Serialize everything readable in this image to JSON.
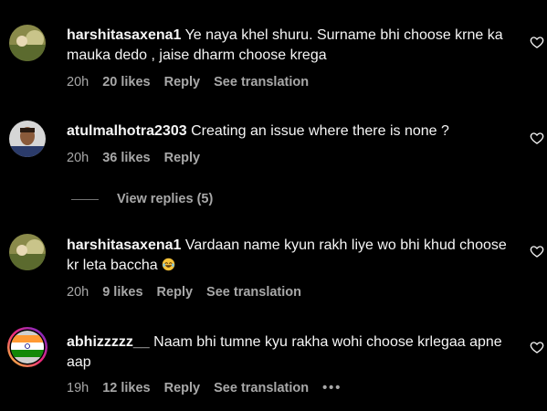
{
  "comments": [
    {
      "username": "harshitasaxena1",
      "text": "Ye naya khel shuru. Surname bhi choose krne ka mauka dedo , jaise dharm choose krega",
      "time": "20h",
      "likes": "20 likes",
      "reply": "Reply",
      "translation": "See translation"
    },
    {
      "username": "atulmalhotra2303",
      "text": "Creating an issue where there is none ?",
      "time": "20h",
      "likes": "36 likes",
      "reply": "Reply",
      "view_replies": "View replies (5)"
    },
    {
      "username": "harshitasaxena1",
      "text": "Vardaan name kyun rakh liye wo bhi khud choose kr leta baccha",
      "time": "20h",
      "likes": "9 likes",
      "reply": "Reply",
      "translation": "See translation"
    },
    {
      "username": "abhizzzzz__",
      "text": "Naam bhi tumne kyu rakha wohi choose krlegaa apne aap",
      "time": "19h",
      "likes": "12 likes",
      "reply": "Reply",
      "translation": "See translation",
      "more": "•••"
    }
  ],
  "colors": {
    "background": "#000000",
    "text": "#f5f5f5",
    "secondary": "#a8a8a8"
  },
  "icons": [
    "heart-icon",
    "more-options-icon",
    "laughing-emoji-icon"
  ]
}
